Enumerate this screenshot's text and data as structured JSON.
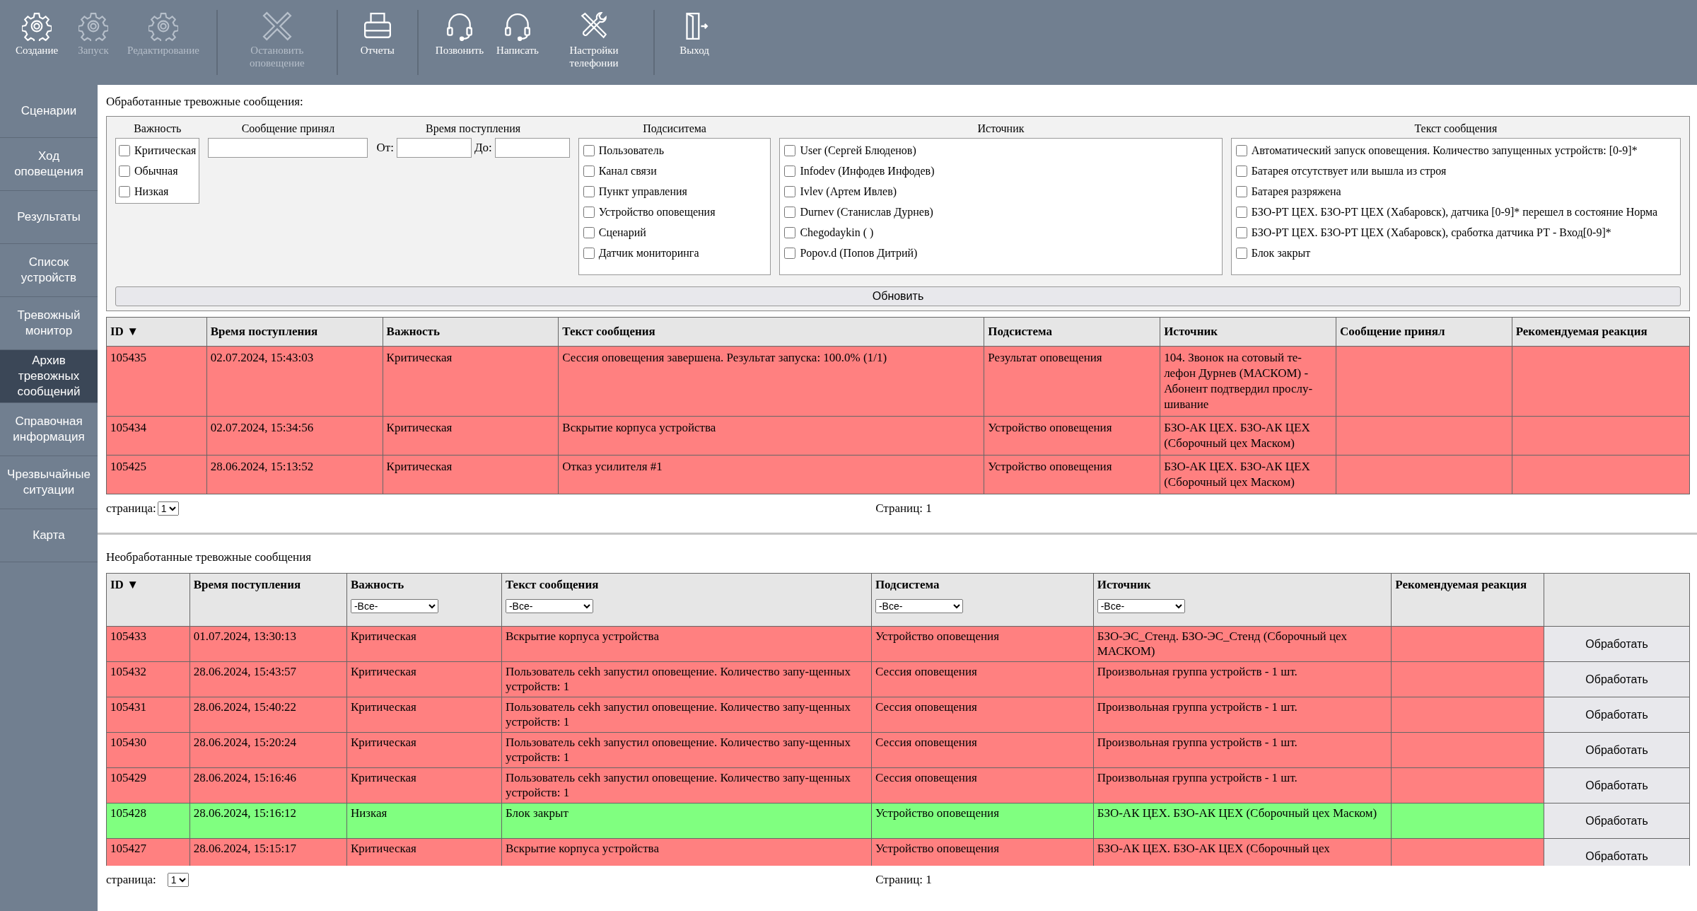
{
  "toolbar": [
    {
      "label": "Создание",
      "disabled": false
    },
    {
      "label": "Запуск",
      "disabled": true
    },
    {
      "label": "Редактирование",
      "disabled": true
    },
    {
      "label": "Остановить оповещение",
      "disabled": true,
      "group_start": true
    },
    {
      "label": "Отчеты",
      "disabled": false,
      "group_start": true
    },
    {
      "label": "Позвонить",
      "disabled": false,
      "group_start": true
    },
    {
      "label": "Написать",
      "disabled": false
    },
    {
      "label": "Настройки телефонии",
      "disabled": false
    },
    {
      "label": "Выход",
      "disabled": false,
      "group_start": true
    }
  ],
  "sidebar": {
    "items": [
      {
        "label": "Сценарии",
        "selected": false
      },
      {
        "label": "Ход оповещения",
        "selected": false
      },
      {
        "label": "Результаты",
        "selected": false
      },
      {
        "label": "Список устройств",
        "selected": false
      },
      {
        "label": "Тревожный монитор",
        "selected": false
      },
      {
        "label": "Архив тревожных сообщений",
        "selected": true
      },
      {
        "label": "Справочная информация",
        "selected": false
      },
      {
        "label": "Чрезвычайные ситуации",
        "selected": false
      },
      {
        "label": "Карта",
        "selected": false
      }
    ]
  },
  "processed": {
    "title": "Обработанные тревожные сообщения:",
    "filters": {
      "importance": {
        "label": "Важность",
        "options": [
          {
            "label": "Критическая",
            "checked": false
          },
          {
            "label": "Обычная",
            "checked": false
          },
          {
            "label": "Низкая",
            "checked": false
          }
        ]
      },
      "accepted": {
        "label": "Сообщение принял"
      },
      "time": {
        "label": "Время поступления",
        "from": "От:",
        "to": "До:"
      },
      "subsystem": {
        "label": "Подсиситема",
        "options": [
          {
            "label": "Пользователь",
            "checked": false
          },
          {
            "label": "Канал связи",
            "checked": false
          },
          {
            "label": "Пункт управления",
            "checked": false
          },
          {
            "label": "Устройство оповещения",
            "checked": false
          },
          {
            "label": "Сценарий",
            "checked": false
          },
          {
            "label": "Датчик мониторинга",
            "checked": false
          }
        ]
      },
      "source": {
        "label": "Источник",
        "options": [
          {
            "label": "User (Сергей Блюденов)",
            "checked": false
          },
          {
            "label": "Infodev (Инфодев Инфодев)",
            "checked": false
          },
          {
            "label": "Ivlev (Артем Ивлев)",
            "checked": false
          },
          {
            "label": "Durnev (Станислав Дурнев)",
            "checked": false
          },
          {
            "label": "Chegodaykin ( )",
            "checked": false
          },
          {
            "label": "Popov.d (Попов Дитрий)",
            "checked": false
          }
        ]
      },
      "text": {
        "label": "Текст сообщения",
        "options": [
          {
            "label": "Автоматический запуск оповещения. Количество запущенных устройств: [0-9]*",
            "checked": false
          },
          {
            "label": "Батарея отсутствует или вышла из строя",
            "checked": false
          },
          {
            "label": "Батарея разряжена",
            "checked": false
          },
          {
            "label": "БЗО-РТ ЦЕХ. БЗО-РТ ЦЕХ (Хабаровск), датчика [0-9]* перешел в состояние Норма",
            "checked": false
          },
          {
            "label": "БЗО-РТ ЦЕХ. БЗО-РТ ЦЕХ (Хабаровск), сработка датчика РТ - Вход[0-9]*",
            "checked": false
          },
          {
            "label": "Блок закрыт",
            "checked": false
          }
        ]
      },
      "refresh_button": "Обновить"
    },
    "table": {
      "columns": [
        "ID ▼",
        "Время поступления",
        "Важность",
        "Текст сообщения",
        "Подсистема",
        "Источник",
        "Сообщение принял",
        "Рекомендуемая реакция"
      ],
      "rows": [
        {
          "color": "#ff8080",
          "cells": [
            "105435",
            "02.07.2024, 15:43:03",
            "Критическая",
            "Сессия оповещения завершена. Результат запуска: 100.0% (1/1)",
            "Результат оповещения",
            "104. Звонок на сотовый те-лефон Дурнев (МАСКОМ) - Абонент подтвердил прослу-шивание",
            "",
            ""
          ]
        },
        {
          "color": "#ff8080",
          "cells": [
            "105434",
            "02.07.2024, 15:34:56",
            "Критическая",
            "Вскрытие корпуса устройства",
            "Устройство оповещения",
            "БЗО-АК ЦЕХ. БЗО-АК ЦЕХ (Сборочный цех Маском)",
            "",
            ""
          ]
        },
        {
          "color": "#ff8080",
          "cells": [
            "105425",
            "28.06.2024, 15:13:52",
            "Критическая",
            "Отказ усилителя #1",
            "Устройство оповещения",
            "БЗО-АК ЦЕХ. БЗО-АК ЦЕХ (Сборочный цех Маском)",
            "",
            ""
          ]
        }
      ]
    },
    "pager": {
      "label": "страница:",
      "page": "1",
      "total": "Страниц: 1"
    }
  },
  "unprocessed": {
    "title": "Необработанные тревожные сообщения",
    "table": {
      "columns": [
        {
          "label": "ID ▼"
        },
        {
          "label": "Время поступления"
        },
        {
          "label": "Важность",
          "filter": "-Все-"
        },
        {
          "label": "Текст сообщения",
          "filter": "-Все-"
        },
        {
          "label": "Подсистема",
          "filter": "-Все-"
        },
        {
          "label": "Источник",
          "filter": "-Все-"
        },
        {
          "label": "Рекомендуемая реакция"
        }
      ],
      "rows": [
        {
          "color": "#ff8080",
          "cells": [
            "105433",
            "01.07.2024, 13:30:13",
            "Критическая",
            "Вскрытие корпуса устройства",
            "Устройство оповещения",
            "БЗО-ЭС_Стенд. БЗО-ЭС_Стенд (Сборочный цех МАСКОМ)",
            ""
          ],
          "action": "Обработать"
        },
        {
          "color": "#ff8080",
          "cells": [
            "105432",
            "28.06.2024, 15:43:57",
            "Критическая",
            "Пользователь cekh запустил оповещение. Количество запу-щенных устройств: 1",
            "Сессия оповещения",
            "Произвольная группа устройств - 1 шт.",
            ""
          ],
          "action": "Обработать"
        },
        {
          "color": "#ff8080",
          "cells": [
            "105431",
            "28.06.2024, 15:40:22",
            "Критическая",
            "Пользователь cekh запустил оповещение. Количество запу-щенных устройств: 1",
            "Сессия оповещения",
            "Произвольная группа устройств - 1 шт.",
            ""
          ],
          "action": "Обработать"
        },
        {
          "color": "#ff8080",
          "cells": [
            "105430",
            "28.06.2024, 15:20:24",
            "Критическая",
            "Пользователь cekh запустил оповещение. Количество запу-щенных устройств: 1",
            "Сессия оповещения",
            "Произвольная группа устройств - 1 шт.",
            ""
          ],
          "action": "Обработать"
        },
        {
          "color": "#ff8080",
          "cells": [
            "105429",
            "28.06.2024, 15:16:46",
            "Критическая",
            "Пользователь cekh запустил оповещение. Количество запу-щенных устройств: 1",
            "Сессия оповещения",
            "Произвольная группа устройств - 1 шт.",
            ""
          ],
          "action": "Обработать"
        },
        {
          "color": "#80ff80",
          "cells": [
            "105428",
            "28.06.2024, 15:16:12",
            "Низкая",
            "Блок закрыт",
            "Устройство оповещения",
            "БЗО-АК ЦЕХ. БЗО-АК ЦЕХ (Сборочный цех Маском)",
            ""
          ],
          "action": "Обработать"
        },
        {
          "color": "#ff8080",
          "cells": [
            "105427",
            "28.06.2024, 15:15:17",
            "Критическая",
            "Вскрытие корпуса устройства",
            "Устройство оповещения",
            "БЗО-АК ЦЕХ. БЗО-АК ЦЕХ (Сборочный цех",
            ""
          ],
          "action": "Обработать"
        }
      ]
    },
    "pager": {
      "label": "страница:",
      "page": "1",
      "total": "Страниц: 1"
    }
  }
}
